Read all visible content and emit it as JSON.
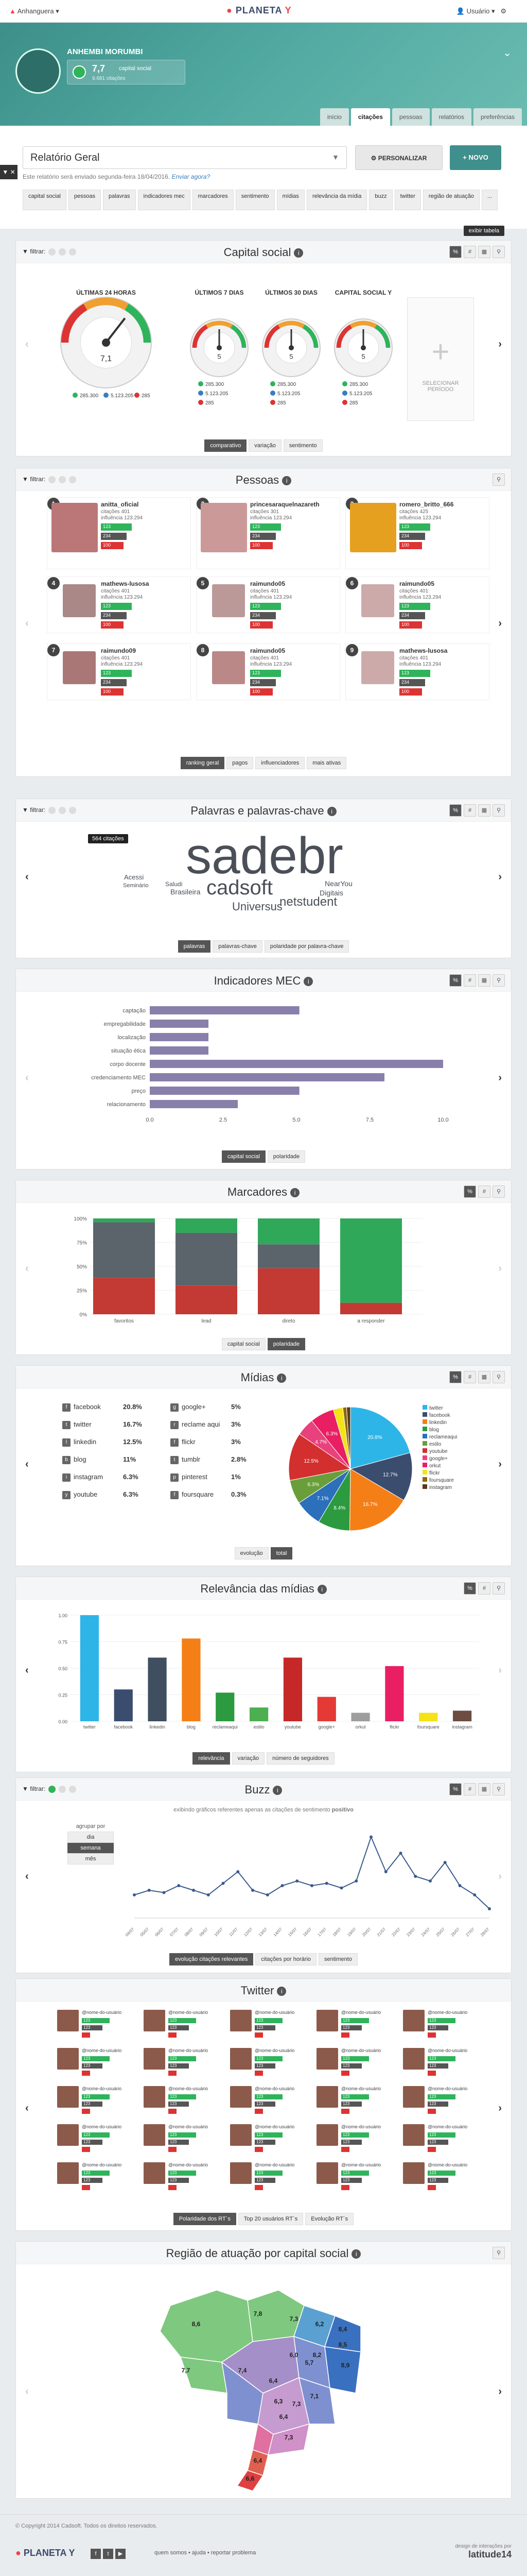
{
  "topbar": {
    "org": "Anhanguera",
    "logo_text": "PLANETA",
    "logo_y": "Y",
    "user": "Usuário"
  },
  "hero": {
    "name": "ANHEMBI MORUMBI",
    "cs_value": "7,7",
    "cs_label": "capital social",
    "cs_sub": "9.681 citações"
  },
  "tabs": [
    "início",
    "citações",
    "pessoas",
    "relatórios",
    "preferências"
  ],
  "report": {
    "select_value": "Relatório Geral",
    "personalizar": "PERSONALIZAR",
    "novo": "+ NOVO",
    "note": "Este relatório será enviado segunda-feira 18/04/2016.",
    "note_link": "Enviar agora?",
    "side_toggle": "▼ ✕"
  },
  "section_tabs": [
    "capital social",
    "pessoas",
    "palavras",
    "indicadores mec",
    "marcadores",
    "sentimento",
    "mídias",
    "relevância da mídia",
    "buzz",
    "twitter",
    "região de atuação",
    "..."
  ],
  "exibir_tabela": "exibir tabela",
  "filter_label": "filtrar:",
  "capital": {
    "title": "Capital social",
    "columns": [
      "ÚLTIMAS 24 HORAS",
      "ÚLTIMOS 7 DIAS",
      "ÚLTIMOS 30 DIAS",
      "CAPITAL SOCIAL Y"
    ],
    "gauges": [
      {
        "value": "7,1",
        "pos": "285.300",
        "neu": "5.123.205",
        "neg": "285",
        "level": 0.71
      },
      {
        "value": "5",
        "pos": "285.300",
        "neu": "5.123.205",
        "neg": "285",
        "level": 0.5
      },
      {
        "value": "5",
        "pos": "285.300",
        "neu": "5.123.205",
        "neg": "285",
        "level": 0.5
      },
      {
        "value": "5",
        "pos": "285.300",
        "neu": "5.123.205",
        "neg": "285",
        "level": 0.5
      }
    ],
    "select_period": "SELECIONAR PERÍODO",
    "subtabs": [
      "comparativo",
      "variação",
      "sentimento"
    ]
  },
  "pessoas": {
    "title": "Pessoas",
    "top": [
      {
        "num": "1",
        "name": "anitta_oficial",
        "l1": "citações 401",
        "l2": "influência 123.294"
      },
      {
        "num": "2",
        "name": "princesaraquelnazareth",
        "l1": "citações 301",
        "l2": "influência 123.294"
      },
      {
        "num": "3",
        "name": "romero_britto_666",
        "l1": "citações 425",
        "l2": "influência 123.294"
      }
    ],
    "rest": [
      {
        "num": "4",
        "name": "mathews-lusosa",
        "l1": "citações 401",
        "l2": "influência 123.294"
      },
      {
        "num": "5",
        "name": "raimundo05",
        "l1": "citações 401",
        "l2": "influência 123.294"
      },
      {
        "num": "6",
        "name": "raimundo05",
        "l1": "citações 401",
        "l2": "influência 123.294"
      },
      {
        "num": "7",
        "name": "raimundo09",
        "l1": "citações 401",
        "l2": "influência 123.294"
      },
      {
        "num": "8",
        "name": "raimundo05",
        "l1": "citações 401",
        "l2": "influência 123.294"
      },
      {
        "num": "9",
        "name": "mathews-lusosa",
        "l1": "citações 401",
        "l2": "influência 123.294"
      }
    ],
    "badges": [
      "123",
      "234",
      "100"
    ],
    "subtabs": [
      "ranking geral",
      "pagos",
      "influenciadores",
      "mais ativas"
    ]
  },
  "palavras": {
    "title": "Palavras e palavras-chave",
    "tooltip": "564 citações",
    "words": [
      "sadebr",
      "cadsoft",
      "Universus",
      "netstudent",
      "Brasileira",
      "Seminário",
      "Digitais",
      "NearYou",
      "Acessi",
      "Saludi"
    ],
    "subtabs": [
      "palavras",
      "palavras-chave",
      "polaridade por palavra-chave"
    ]
  },
  "chart_data": [
    {
      "type": "bar",
      "title": "Indicadores MEC",
      "categories": [
        "captação",
        "empregabilidade",
        "localização",
        "situação ética",
        "corpo docente",
        "credenciamento MEC",
        "preço",
        "relacionamento"
      ],
      "values": [
        5.1,
        2.0,
        2.0,
        2.0,
        10.0,
        8.0,
        5.1,
        3.0
      ],
      "xlim": [
        0,
        10
      ],
      "xticks": [
        "0.0",
        "2.5",
        "5.0",
        "7.5",
        "10.0"
      ],
      "color": "#8880aa",
      "subtabs": [
        "capital social",
        "polaridade"
      ]
    },
    {
      "type": "bar",
      "title": "Marcadores",
      "categories": [
        "favoritos",
        "lead",
        "direto",
        "a responder"
      ],
      "series": [
        {
          "values": [
            38,
            30,
            48,
            12
          ],
          "color": "#c23a33"
        },
        {
          "values": [
            58,
            55,
            25,
            0
          ],
          "color": "#5b646b"
        },
        {
          "values": [
            4,
            15,
            27,
            88
          ],
          "color": "#2fa85a"
        }
      ],
      "yticks": [
        "0%",
        "25%",
        "50%",
        "75%",
        "100%"
      ],
      "subtabs": [
        "capital social",
        "polaridade"
      ]
    },
    {
      "type": "pie",
      "title": "Mídias",
      "items": [
        {
          "name": "facebook",
          "pct": "20.8%"
        },
        {
          "name": "twitter",
          "pct": "16.7%"
        },
        {
          "name": "linkedin",
          "pct": "12.5%"
        },
        {
          "name": "blog",
          "pct": "11%"
        },
        {
          "name": "instagram",
          "pct": "6.3%"
        },
        {
          "name": "youtube",
          "pct": "6.3%"
        },
        {
          "name": "google+",
          "pct": "5%"
        },
        {
          "name": "reclame aqui",
          "pct": "3%"
        },
        {
          "name": "flickr",
          "pct": "3%"
        },
        {
          "name": "tumblr",
          "pct": "2.8%"
        },
        {
          "name": "pinterest",
          "pct": "1%"
        },
        {
          "name": "foursquare",
          "pct": "0.3%"
        }
      ],
      "slices": [
        {
          "name": "twitter",
          "value": 20.8,
          "color": "#2eb5e8"
        },
        {
          "name": "facebook",
          "value": 12.7,
          "color": "#3a4d6f"
        },
        {
          "name": "linkedin",
          "value": 16.7,
          "color": "#f57f17"
        },
        {
          "name": "blog",
          "value": 8.4,
          "color": "#2c9a3f"
        },
        {
          "name": "reclameaqui",
          "value": 7.1,
          "color": "#2c6fbb"
        },
        {
          "name": "estilo",
          "value": 6.3,
          "color": "#6a9e3a"
        },
        {
          "name": "youtube",
          "value": 12.5,
          "color": "#d32f2f"
        },
        {
          "name": "google+",
          "value": 4.7,
          "color": "#e8417c"
        },
        {
          "name": "orkut",
          "value": 6.3,
          "color": "#e91e63"
        },
        {
          "name": "flickr",
          "value": 2.5,
          "color": "#f3e318"
        },
        {
          "name": "foursquare",
          "value": 1.0,
          "color": "#8b6914"
        },
        {
          "name": "instagram",
          "value": 1.0,
          "color": "#5a3a1a"
        }
      ],
      "slice_labels": [
        "20.8%",
        "12.7%",
        "16.7%",
        "8.4%",
        "7.1%",
        "6.3%",
        "12.5%",
        "4.7%",
        "6.3%"
      ],
      "legend": [
        "twitter",
        "facebook",
        "linkedin",
        "blog",
        "reclameaqui",
        "estilo",
        "youtube",
        "google+",
        "orkut",
        "flickr",
        "foursquare",
        "instagram"
      ],
      "subtabs": [
        "evolução",
        "total"
      ]
    },
    {
      "type": "bar",
      "title": "Relevância das mídias",
      "categories": [
        "twitter",
        "facebook",
        "linkedin",
        "blog",
        "reclameaqui",
        "estilo",
        "youtube",
        "google+",
        "orkut",
        "flickr",
        "foursquare",
        "instagram"
      ],
      "values": [
        1.0,
        0.3,
        0.6,
        0.78,
        0.27,
        0.13,
        0.6,
        0.23,
        0.08,
        0.52,
        0.08,
        0.1
      ],
      "colors": [
        "#2eb5e8",
        "#3a4d6f",
        "#3f4f5f",
        "#f57f17",
        "#2c9a3f",
        "#4caf50",
        "#c62828",
        "#e53935",
        "#9e9e9e",
        "#e91e63",
        "#f3e318",
        "#6d4c41"
      ],
      "ylim": [
        0,
        1
      ],
      "yticks": [
        "0.00",
        "0.25",
        "0.50",
        "0.75",
        "1.00"
      ],
      "subtabs": [
        "relevância",
        "variação",
        "número de seguidores"
      ]
    },
    {
      "type": "line",
      "title": "Buzz",
      "note": "exibindo gráficos referentes apenas as citações de sentimento",
      "note_strong": "positivo",
      "x": [
        "04/07",
        "05/07",
        "06/07",
        "07/07",
        "08/07",
        "09/07",
        "10/07",
        "11/07",
        "12/07",
        "13/07",
        "14/07",
        "15/07",
        "16/07",
        "17/07",
        "18/07",
        "19/07",
        "20/07",
        "21/07",
        "22/07",
        "23/07",
        "24/07",
        "25/07",
        "26/07",
        "27/07",
        "28/07"
      ],
      "values": [
        10,
        12,
        11,
        14,
        12,
        10,
        15,
        20,
        12,
        10,
        14,
        16,
        14,
        15,
        13,
        16,
        35,
        20,
        28,
        18,
        16,
        24,
        14,
        10,
        4
      ],
      "ylim": [
        0,
        40
      ],
      "agrupar_label": "agrupar por",
      "agrupar_options": [
        "dia",
        "semana",
        "mês"
      ],
      "subtabs": [
        "evolução citações relevantes",
        "citações por horário",
        "sentimento"
      ]
    }
  ],
  "twitter": {
    "title": "Twitter",
    "user_label": "@nome-do-usuário",
    "badge_a": "123",
    "badge_b": "123",
    "subtabs": [
      "Polaridade dos RT´s",
      "Top 20 usuários RT´s",
      "Evolução RT´s"
    ]
  },
  "regiao": {
    "title": "Região de atuação por capital social",
    "states": [
      {
        "v": "8,6"
      },
      {
        "v": "7,8"
      },
      {
        "v": "7,3"
      },
      {
        "v": "6,2"
      },
      {
        "v": "8,4"
      },
      {
        "v": "8,2"
      },
      {
        "v": "8,9"
      },
      {
        "v": "5,7"
      },
      {
        "v": "6,0"
      },
      {
        "v": "8,5"
      },
      {
        "v": "7,7"
      },
      {
        "v": "7,4"
      },
      {
        "v": "6,4"
      },
      {
        "v": "6,3"
      },
      {
        "v": "7,3"
      },
      {
        "v": "7,1"
      },
      {
        "v": "6,4"
      },
      {
        "v": "7,3"
      },
      {
        "v": "6,4"
      },
      {
        "v": "6,6"
      }
    ]
  },
  "footer": {
    "copy": "© Copyright 2014 Cadsoft. Todos os direitos reservados.",
    "logo": "PLANETA Y",
    "links": "quem somos  •  ajuda  •  reportar problema",
    "credit": "design de interações por",
    "credit_brand": "latitude14"
  },
  "colors": {
    "positive": "#2fb35b",
    "neutral": "#3a7dc0",
    "negative": "#d33",
    "teal": "#3f8f8d"
  }
}
